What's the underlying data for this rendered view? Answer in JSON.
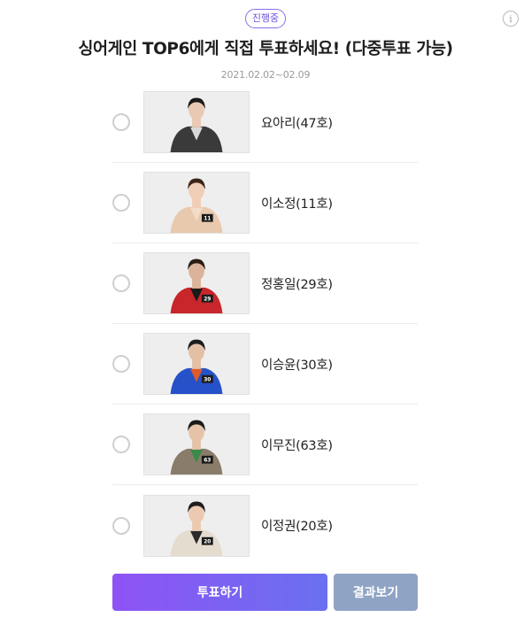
{
  "poll": {
    "status": "진행중",
    "title": "싱어게인 TOP6에게 직접 투표하세요! (다중투표 가능)",
    "period": "2021.02.02~02.09"
  },
  "candidates": [
    {
      "name": "요아리(47호)",
      "selected": false,
      "number_tag": "",
      "outfit": "sequin-black-white",
      "colors": {
        "jacket": "#3a3a3a",
        "accent": "#d9d9d9",
        "hair": "#1a1a1a",
        "skin": "#e9c9b3"
      }
    },
    {
      "name": "이소정(11호)",
      "selected": false,
      "number_tag": "11",
      "outfit": "beige-top",
      "colors": {
        "jacket": "#e8c9ae",
        "accent": "#f2dcc8",
        "hair": "#3b2418",
        "skin": "#f0cdb6"
      }
    },
    {
      "name": "정홍일(29호)",
      "selected": false,
      "number_tag": "29",
      "outfit": "red-leather-jacket",
      "colors": {
        "jacket": "#c8262a",
        "accent": "#1a1a1a",
        "hair": "#2a1c14",
        "skin": "#dbb39a"
      }
    },
    {
      "name": "이승윤(30호)",
      "selected": false,
      "number_tag": "30",
      "outfit": "blue-windbreaker",
      "colors": {
        "jacket": "#2552c9",
        "accent": "#e05a2a",
        "hair": "#1c1c1c",
        "skin": "#e3bfa4"
      }
    },
    {
      "name": "이무진(63호)",
      "selected": false,
      "number_tag": "63",
      "outfit": "plaid-jacket",
      "colors": {
        "jacket": "#8a7c6a",
        "accent": "#3a8a4a",
        "hair": "#1a1a1a",
        "skin": "#e6c3a8"
      }
    },
    {
      "name": "이정권(20호)",
      "selected": false,
      "number_tag": "20",
      "outfit": "light-suit",
      "colors": {
        "jacket": "#e4dccf",
        "accent": "#2a2a2a",
        "hair": "#1e1e1e",
        "skin": "#ecc9b1"
      }
    }
  ],
  "buttons": {
    "vote": "투표하기",
    "results": "결과보기"
  },
  "icons": {
    "info": "info-icon"
  },
  "colors": {
    "accent": "#7b5cf0",
    "result_button": "#8fa3c5"
  }
}
